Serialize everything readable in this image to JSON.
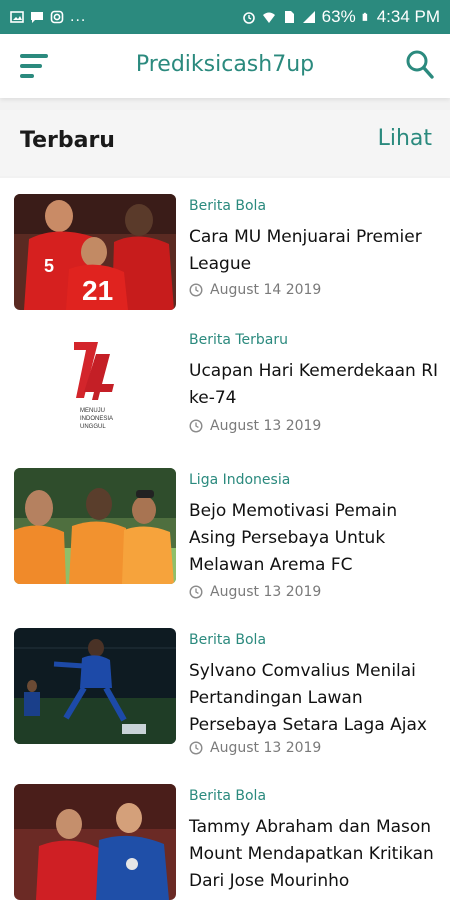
{
  "status_bar": {
    "battery": "63%",
    "time": "4:34 PM",
    "overflow": "..."
  },
  "app_bar": {
    "title": "Prediksicash7up",
    "menu_icon": "menu-icon",
    "search_icon": "search-icon"
  },
  "section": {
    "title": "Terbaru",
    "link": "Lihat"
  },
  "articles": [
    {
      "category": "Berita Bola",
      "title": "Cara MU Menjuarai Premier League",
      "date": "August 14 2019"
    },
    {
      "category": "Berita Terbaru",
      "title": "Ucapan Hari Kemerdekaan RI ke-74",
      "date": "August 13 2019"
    },
    {
      "category": "Liga Indonesia",
      "title": "Bejo Memotivasi Pemain Asing Persebaya Untuk Melawan Arema FC",
      "date": "August 13 2019"
    },
    {
      "category": "Berita Bola",
      "title": "Sylvano Comvalius Menilai Pertandingan Lawan Persebaya Setara Laga Ajax",
      "date": "August 13 2019"
    },
    {
      "category": "Berita Bola",
      "title": "Tammy Abraham dan Mason Mount Mendapatkan Kritikan Dari Jose Mourinho",
      "date": ""
    }
  ],
  "colors": {
    "accent": "#2b8a7e",
    "text": "#111111",
    "muted": "#7a7a7a"
  }
}
